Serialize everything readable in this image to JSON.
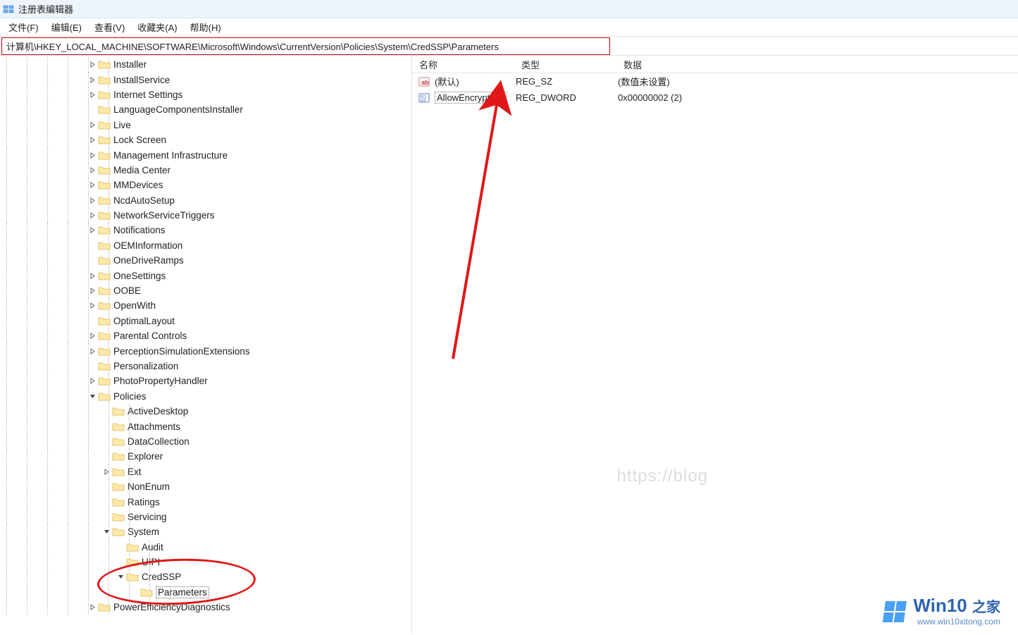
{
  "window": {
    "title": "注册表编辑器"
  },
  "menu": {
    "file": "文件(F)",
    "edit": "编辑(E)",
    "view": "查看(V)",
    "favorites": "收藏夹(A)",
    "help": "帮助(H)"
  },
  "address": "计算机\\HKEY_LOCAL_MACHINE\\SOFTWARE\\Microsoft\\Windows\\CurrentVersion\\Policies\\System\\CredSSP\\Parameters",
  "tree": [
    {
      "indent": 6,
      "expander": ">",
      "label": "Installer"
    },
    {
      "indent": 6,
      "expander": ">",
      "label": "InstallService"
    },
    {
      "indent": 6,
      "expander": ">",
      "label": "Internet Settings"
    },
    {
      "indent": 6,
      "expander": "",
      "label": "LanguageComponentsInstaller"
    },
    {
      "indent": 6,
      "expander": ">",
      "label": "Live"
    },
    {
      "indent": 6,
      "expander": ">",
      "label": "Lock Screen"
    },
    {
      "indent": 6,
      "expander": ">",
      "label": "Management Infrastructure"
    },
    {
      "indent": 6,
      "expander": ">",
      "label": "Media Center"
    },
    {
      "indent": 6,
      "expander": ">",
      "label": "MMDevices"
    },
    {
      "indent": 6,
      "expander": ">",
      "label": "NcdAutoSetup"
    },
    {
      "indent": 6,
      "expander": ">",
      "label": "NetworkServiceTriggers"
    },
    {
      "indent": 6,
      "expander": ">",
      "label": "Notifications"
    },
    {
      "indent": 6,
      "expander": "",
      "label": "OEMInformation"
    },
    {
      "indent": 6,
      "expander": "",
      "label": "OneDriveRamps"
    },
    {
      "indent": 6,
      "expander": ">",
      "label": "OneSettings"
    },
    {
      "indent": 6,
      "expander": ">",
      "label": "OOBE"
    },
    {
      "indent": 6,
      "expander": ">",
      "label": "OpenWith"
    },
    {
      "indent": 6,
      "expander": "",
      "label": "OptimalLayout"
    },
    {
      "indent": 6,
      "expander": ">",
      "label": "Parental Controls"
    },
    {
      "indent": 6,
      "expander": ">",
      "label": "PerceptionSimulationExtensions"
    },
    {
      "indent": 6,
      "expander": "",
      "label": "Personalization"
    },
    {
      "indent": 6,
      "expander": ">",
      "label": "PhotoPropertyHandler"
    },
    {
      "indent": 6,
      "expander": "v",
      "label": "Policies"
    },
    {
      "indent": 7,
      "expander": "",
      "label": "ActiveDesktop"
    },
    {
      "indent": 7,
      "expander": "",
      "label": "Attachments"
    },
    {
      "indent": 7,
      "expander": "",
      "label": "DataCollection"
    },
    {
      "indent": 7,
      "expander": "",
      "label": "Explorer"
    },
    {
      "indent": 7,
      "expander": ">",
      "label": "Ext"
    },
    {
      "indent": 7,
      "expander": "",
      "label": "NonEnum"
    },
    {
      "indent": 7,
      "expander": "",
      "label": "Ratings"
    },
    {
      "indent": 7,
      "expander": "",
      "label": "Servicing"
    },
    {
      "indent": 7,
      "expander": "v",
      "label": "System"
    },
    {
      "indent": 8,
      "expander": "",
      "label": "Audit"
    },
    {
      "indent": 8,
      "expander": "",
      "label": "UIPI"
    },
    {
      "indent": 8,
      "expander": "v",
      "label": "CredSSP"
    },
    {
      "indent": 9,
      "expander": "",
      "label": "Parameters",
      "selected": true
    },
    {
      "indent": 6,
      "expander": ">",
      "label": "PowerEfficiencyDiagnostics"
    }
  ],
  "columns": {
    "name": "名称",
    "type": "类型",
    "data": "数据"
  },
  "values": [
    {
      "icon": "sz",
      "name": "(默认)",
      "type": "REG_SZ",
      "data": "(数值未设置)"
    },
    {
      "icon": "dw",
      "name": "AllowEncryptio...",
      "type": "REG_DWORD",
      "data": "0x00000002 (2)",
      "selected": true
    }
  ],
  "watermark": {
    "brand": "Win10",
    "brand_cn": "之家",
    "url": "www.win10xitong.com",
    "faded": "https://blog"
  }
}
